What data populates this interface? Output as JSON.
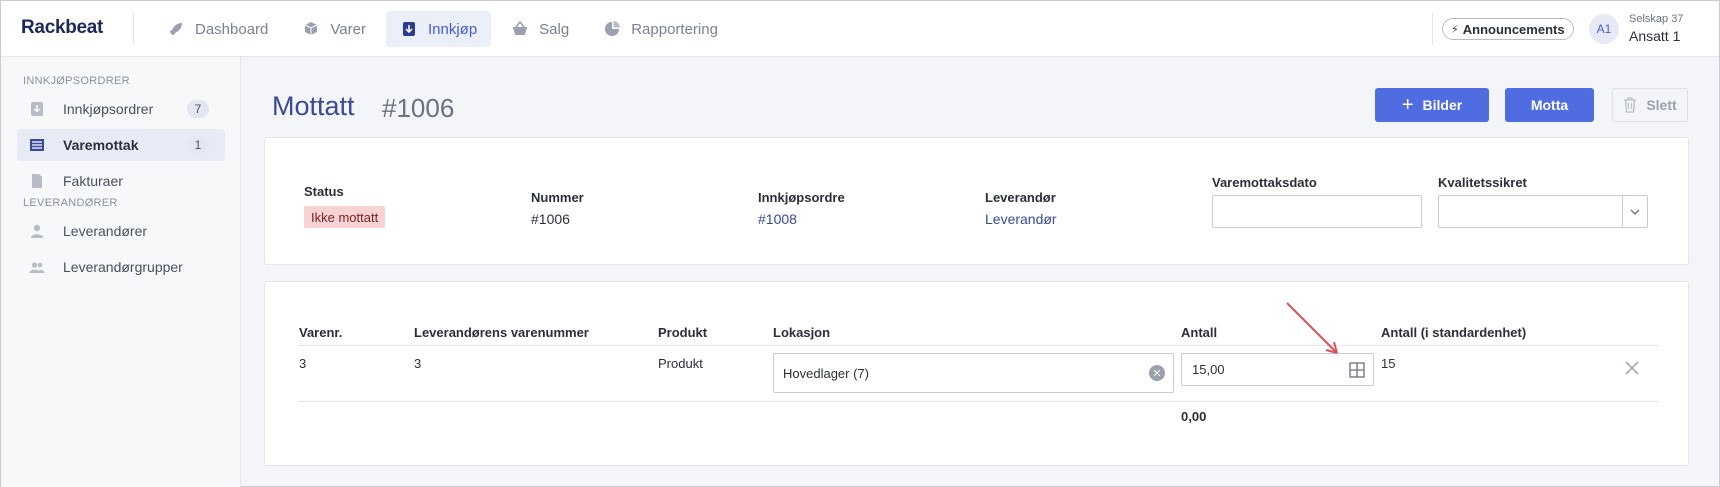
{
  "topbar": {
    "logo": "Rackbeat",
    "nav": [
      {
        "label": "Dashboard",
        "icon": "rocket-icon",
        "active": false
      },
      {
        "label": "Varer",
        "icon": "box-icon",
        "active": false
      },
      {
        "label": "Innkjøp",
        "icon": "download-icon",
        "active": true
      },
      {
        "label": "Salg",
        "icon": "basket-icon",
        "active": false
      },
      {
        "label": "Rapportering",
        "icon": "pie-chart-icon",
        "active": false
      }
    ],
    "announcements_label": "Announcements",
    "avatar_initials": "A1",
    "company": "Selskap 37",
    "user": "Ansatt 1"
  },
  "sidebar": {
    "section1": "INNKJØPSORDRER",
    "items1": [
      {
        "label": "Innkjøpsordrer",
        "badge": "7",
        "icon": "download-icon"
      },
      {
        "label": "Varemottak",
        "badge": "1",
        "icon": "list-icon"
      },
      {
        "label": "Fakturaer",
        "badge": "",
        "icon": "file-icon"
      }
    ],
    "section2": "LEVERANDØRER",
    "items2": [
      {
        "label": "Leverandører",
        "icon": "user-icon"
      },
      {
        "label": "Leverandørgrupper",
        "icon": "users-icon"
      }
    ]
  },
  "page": {
    "title": "Mottatt",
    "number": "#1006",
    "buttons": {
      "bilder": "Bilder",
      "motta": "Motta",
      "slett": "Slett"
    }
  },
  "info": {
    "status_label": "Status",
    "status_value": "Ikke mottatt",
    "nummer_label": "Nummer",
    "nummer_value": "#1006",
    "ordre_label": "Innkjøpsordre",
    "ordre_value": "#1008",
    "leverandor_label": "Leverandør",
    "leverandor_value": "Leverandør",
    "dato_label": "Varemottaksdato",
    "dato_value": "",
    "kvalitet_label": "Kvalitetssikret",
    "kvalitet_value": ""
  },
  "lines": {
    "headers": [
      "Varenr.",
      "Leverandørens varenummer",
      "Produkt",
      "Lokasjon",
      "Antall",
      "Antall (i standardenhet)"
    ],
    "rows": [
      {
        "varenr": "3",
        "lev_varenr": "3",
        "produkt": "Produkt",
        "lokasjon": "Hovedlager (7)",
        "antall": "15,00",
        "antall_std": "15"
      }
    ],
    "total": "0,00"
  },
  "colors": {
    "primary": "#4f6ce1",
    "accent": "#3a4a96",
    "status_bg": "#f7d3d3",
    "annotation": "#e0505a"
  }
}
